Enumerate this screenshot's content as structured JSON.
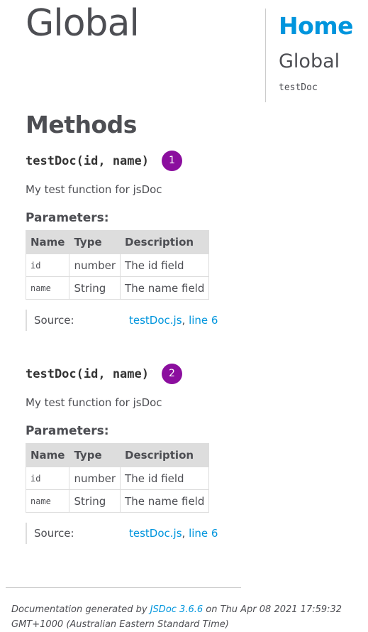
{
  "page_title": "Global",
  "nav": {
    "home": "Home",
    "section": "Global",
    "links": [
      "testDoc"
    ]
  },
  "methods_heading": "Methods",
  "methods": [
    {
      "signature": "testDoc(id, name)",
      "badge": "1",
      "description": "My test function for jsDoc",
      "params_title": "Parameters:",
      "columns": [
        "Name",
        "Type",
        "Description"
      ],
      "params": [
        {
          "name": "id",
          "type": "number",
          "description": "The id field"
        },
        {
          "name": "name",
          "type": "String",
          "description": "The name field"
        }
      ],
      "source_label": "Source:",
      "source_file": "testDoc.js",
      "source_sep": ",",
      "source_line": "line 6"
    },
    {
      "signature": "testDoc(id, name)",
      "badge": "2",
      "description": "My test function for jsDoc",
      "params_title": "Parameters:",
      "columns": [
        "Name",
        "Type",
        "Description"
      ],
      "params": [
        {
          "name": "id",
          "type": "number",
          "description": "The id field"
        },
        {
          "name": "name",
          "type": "String",
          "description": "The name field"
        }
      ],
      "source_label": "Source:",
      "source_file": "testDoc.js",
      "source_sep": ",",
      "source_line": "line 6"
    }
  ],
  "footer": {
    "prefix": "Documentation generated by",
    "link": "JSDoc 3.6.6",
    "suffix": "on Thu Apr 08 2021 17:59:32 GMT+1000 (Australian Eastern Standard Time)"
  },
  "colors": {
    "link": "#0095dd",
    "badge": "#8b0e9e",
    "text": "#4d4e53",
    "table_header": "#dddddd"
  }
}
